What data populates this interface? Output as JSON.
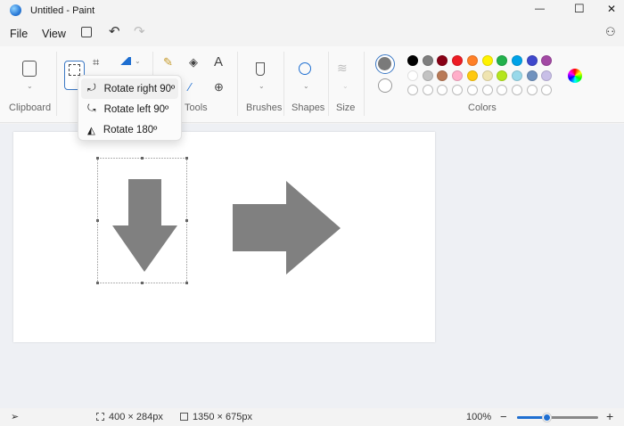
{
  "window": {
    "title": "Untitled - Paint",
    "minimize": "—",
    "maximize": "☐",
    "close": "✕"
  },
  "menu": {
    "file": "File",
    "view": "View"
  },
  "ribbon": {
    "groups": {
      "clipboard": "Clipboard",
      "tools": "Tools",
      "brushes": "Brushes",
      "shapes": "Shapes",
      "size": "Size",
      "colors": "Colors"
    }
  },
  "rotate_menu": {
    "items": [
      {
        "label": "Rotate right 90º"
      },
      {
        "label": "Rotate left 90º"
      },
      {
        "label": "Rotate 180º"
      }
    ]
  },
  "colors": {
    "primary": "#7a7a7a",
    "secondary": "#ffffff",
    "row1": [
      "#000000",
      "#7f7f7f",
      "#880015",
      "#ed1c24",
      "#ff7f27",
      "#fff200",
      "#22b14c",
      "#00a2e8",
      "#3f48cc",
      "#a349a4"
    ],
    "row2": [
      "#ffffff",
      "#c3c3c3",
      "#b97a57",
      "#ffaec9",
      "#ffc90e",
      "#efe4b0",
      "#b5e61d",
      "#99d9ea",
      "#7092be",
      "#c8bfe7"
    ]
  },
  "status": {
    "selection_size": "400 × 284px",
    "canvas_size": "1350 × 675px",
    "zoom": "100%",
    "zoom_level_percent": 100,
    "minus": "−",
    "plus": "+"
  },
  "shape_color": "#808080"
}
